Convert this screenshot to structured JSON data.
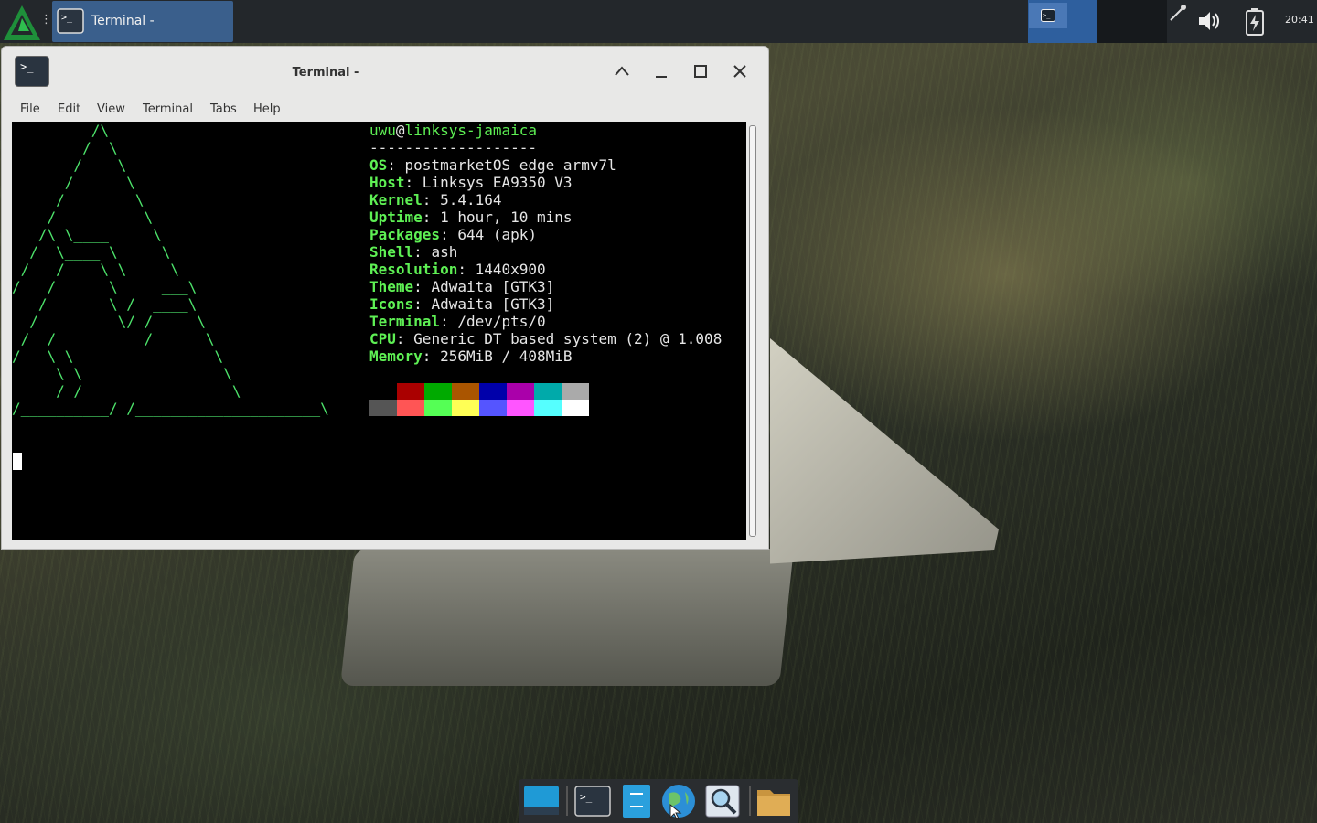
{
  "top_panel": {
    "taskbar_label": "Terminal -",
    "clock": "20:41"
  },
  "window": {
    "title": "Terminal -",
    "menu": [
      "File",
      "Edit",
      "View",
      "Terminal",
      "Tabs",
      "Help"
    ]
  },
  "terminal": {
    "ascii_art": "         /\\\n        /  \\\n       /    \\\n      /      \\\n     /        \\\n    /          \\\n   /\\ \\____     \\\n  /  \\____ \\     \\\n /   /    \\ \\     \\\n/   /      \\     ___\\\n   /       \\ /  ____\\\n  /         \\/ /     \\\n /  /__________/      \\\n/   \\ \\                \\\n     \\ \\                \\\n     / /                 \\\n/__________/ /_____________________\\",
    "user": "uwu",
    "at": "@",
    "host": "linksys-jamaica",
    "separator": "-------------------",
    "fields": [
      {
        "key": "OS",
        "value": "postmarketOS edge armv7l"
      },
      {
        "key": "Host",
        "value": "Linksys EA9350 V3"
      },
      {
        "key": "Kernel",
        "value": "5.4.164"
      },
      {
        "key": "Uptime",
        "value": "1 hour, 10 mins"
      },
      {
        "key": "Packages",
        "value": "644 (apk)"
      },
      {
        "key": "Shell",
        "value": "ash"
      },
      {
        "key": "Resolution",
        "value": "1440x900"
      },
      {
        "key": "Theme",
        "value": "Adwaita [GTK3]"
      },
      {
        "key": "Icons",
        "value": "Adwaita [GTK3]"
      },
      {
        "key": "Terminal",
        "value": "/dev/pts/0"
      },
      {
        "key": "CPU",
        "value": "Generic DT based system (2) @ 1.008"
      },
      {
        "key": "Memory",
        "value": "256MiB / 408MiB"
      }
    ],
    "palette_row1": [
      "#000000",
      "#aa0000",
      "#00aa00",
      "#aa5500",
      "#0000aa",
      "#aa00aa",
      "#00aaaa",
      "#aaaaaa"
    ],
    "palette_row2": [
      "#555555",
      "#ff5555",
      "#55ff55",
      "#ffff55",
      "#5555ff",
      "#ff55ff",
      "#55ffff",
      "#ffffff"
    ]
  },
  "colors": {
    "accent": "#3a5f8c",
    "terminal_green": "#4de36b"
  },
  "dock": {
    "icons": [
      "desktop-icon",
      "terminal-icon",
      "file-manager-icon",
      "web-browser-icon",
      "app-finder-icon",
      "folder-icon"
    ]
  }
}
